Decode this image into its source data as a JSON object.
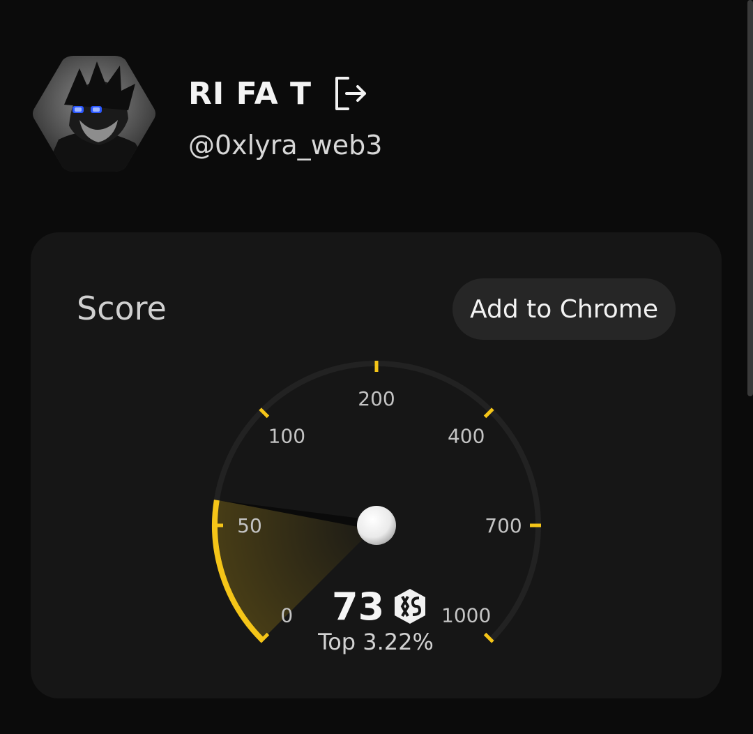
{
  "profile": {
    "display_name": "RI FA T",
    "handle": "@0xlyra_web3",
    "avatar_icon": "hexagon-avatar",
    "logout_icon": "logout-icon"
  },
  "score_card": {
    "title": "Score",
    "add_to_chrome_label": "Add to Chrome",
    "score": "73",
    "rank": "Top 3.22%",
    "brand_icon": "xs-logo-icon",
    "gauge": {
      "tick_labels": [
        "0",
        "50",
        "100",
        "200",
        "400",
        "700",
        "1000"
      ],
      "value_fraction": 0.2,
      "accent_color": "#f5c518",
      "track_color": "#222222"
    }
  }
}
